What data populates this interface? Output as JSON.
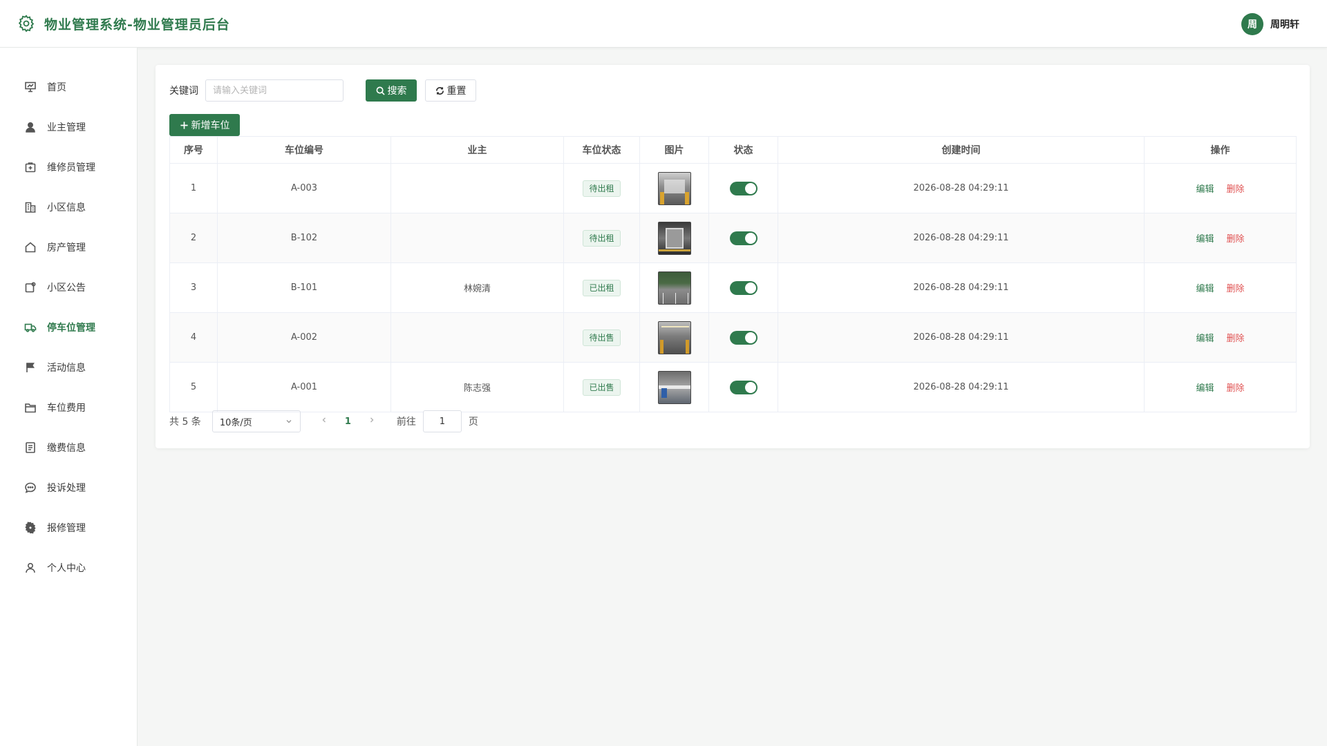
{
  "header": {
    "title": "物业管理系统-物业管理员后台",
    "user_avatar": "周",
    "user_name": "周明轩"
  },
  "sidebar": {
    "items": [
      {
        "label": "首页",
        "icon": "dashboard-icon"
      },
      {
        "label": "业主管理",
        "icon": "user-icon"
      },
      {
        "label": "维修员管理",
        "icon": "repair-box-icon"
      },
      {
        "label": "小区信息",
        "icon": "building-icon"
      },
      {
        "label": "房产管理",
        "icon": "house-icon"
      },
      {
        "label": "小区公告",
        "icon": "notice-icon"
      },
      {
        "label": "停车位管理",
        "icon": "truck-icon",
        "active": true
      },
      {
        "label": "活动信息",
        "icon": "flag-icon"
      },
      {
        "label": "车位费用",
        "icon": "folder-icon"
      },
      {
        "label": "缴费信息",
        "icon": "document-icon"
      },
      {
        "label": "投诉处理",
        "icon": "chat-icon"
      },
      {
        "label": "报修管理",
        "icon": "gear-icon"
      },
      {
        "label": "个人中心",
        "icon": "person-icon"
      }
    ]
  },
  "search": {
    "label": "关键词",
    "placeholder": "请输入关键词",
    "search_button": "搜索",
    "reset_button": "重置"
  },
  "toolbar": {
    "add_button": "新增车位"
  },
  "table": {
    "columns": [
      "序号",
      "车位编号",
      "业主",
      "车位状态",
      "图片",
      "状态",
      "创建时间",
      "操作"
    ],
    "rows": [
      {
        "index": "1",
        "code": "A-003",
        "owner": "",
        "status": "待出租",
        "enabled": true,
        "created": "2026-08-28 04:29:11"
      },
      {
        "index": "2",
        "code": "B-102",
        "owner": "",
        "status": "待出租",
        "enabled": true,
        "created": "2026-08-28 04:29:11"
      },
      {
        "index": "3",
        "code": "B-101",
        "owner": "林婉清",
        "status": "已出租",
        "enabled": true,
        "created": "2026-08-28 04:29:11"
      },
      {
        "index": "4",
        "code": "A-002",
        "owner": "",
        "status": "待出售",
        "enabled": true,
        "created": "2026-08-28 04:29:11"
      },
      {
        "index": "5",
        "code": "A-001",
        "owner": "陈志强",
        "status": "已出售",
        "enabled": true,
        "created": "2026-08-28 04:29:11"
      }
    ],
    "edit_label": "编辑",
    "delete_label": "删除"
  },
  "pagination": {
    "total_text": "共 5 条",
    "page_size": "10条/页",
    "current_page": "1",
    "goto_label": "前往",
    "goto_value": "1",
    "page_unit": "页"
  },
  "colors": {
    "accent": "#2f7a4d",
    "danger": "#e05252"
  }
}
